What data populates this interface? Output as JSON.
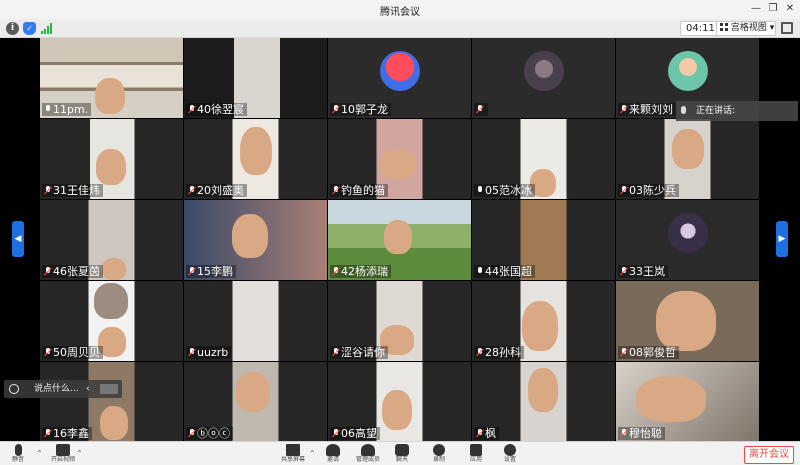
{
  "app": {
    "title": "腾讯会议"
  },
  "toolbar": {
    "timer": "04:11",
    "view_mode": "宫格视图",
    "view_mode_chevron": "▾"
  },
  "speaking": {
    "label": "正在讲话:"
  },
  "chat": {
    "placeholder": "说点什么...",
    "arrow": "‹"
  },
  "participants": [
    {
      "name": "11pm.",
      "muted": false
    },
    {
      "name": "40徐翌宸",
      "muted": true
    },
    {
      "name": "10郭子龙",
      "muted": true
    },
    {
      "name": "",
      "muted": true
    },
    {
      "name": "来颗刘刘",
      "muted": true
    },
    {
      "name": "31王佳炜",
      "muted": true
    },
    {
      "name": "20刘盛奥",
      "muted": true
    },
    {
      "name": "钓鱼的猫",
      "muted": true
    },
    {
      "name": "05范冰冰",
      "muted": false
    },
    {
      "name": "03陈少兵",
      "muted": true
    },
    {
      "name": "46张夏茵",
      "muted": true
    },
    {
      "name": "15李鹏",
      "muted": true
    },
    {
      "name": "42杨添瑞",
      "muted": true
    },
    {
      "name": "44张国超",
      "muted": false
    },
    {
      "name": "33王岚",
      "muted": true
    },
    {
      "name": "50周贝贝",
      "muted": true
    },
    {
      "name": "uuzrb",
      "muted": true
    },
    {
      "name": "涩谷请你",
      "muted": true
    },
    {
      "name": "28孙科",
      "muted": true
    },
    {
      "name": "08郭俊哲",
      "muted": true
    },
    {
      "name": "16李鑫",
      "muted": true
    },
    {
      "name": "ⓑⓞⓒ",
      "muted": true
    },
    {
      "name": "06高望",
      "muted": true
    },
    {
      "name": "枫",
      "muted": true
    },
    {
      "name": "穆怡聪",
      "muted": true
    }
  ],
  "bottombar": {
    "items": [
      {
        "label": "静音",
        "icon": "microphone-icon"
      },
      {
        "label": "开启视频",
        "icon": "video-camera-icon"
      },
      {
        "label": "共享屏幕",
        "icon": "screen-share-icon"
      },
      {
        "label": "邀请",
        "icon": "invite-user-icon"
      },
      {
        "label": "管理成员",
        "icon": "members-icon"
      },
      {
        "label": "聊天",
        "icon": "chat-icon"
      },
      {
        "label": "录制",
        "icon": "record-icon"
      },
      {
        "label": "应用",
        "icon": "apps-icon"
      },
      {
        "label": "设置",
        "icon": "settings-gear-icon"
      }
    ],
    "leave": "离开会议"
  },
  "colors": {
    "accent": "#1e6fe0",
    "leave": "#e94a4a",
    "signal": "#25b34a"
  }
}
